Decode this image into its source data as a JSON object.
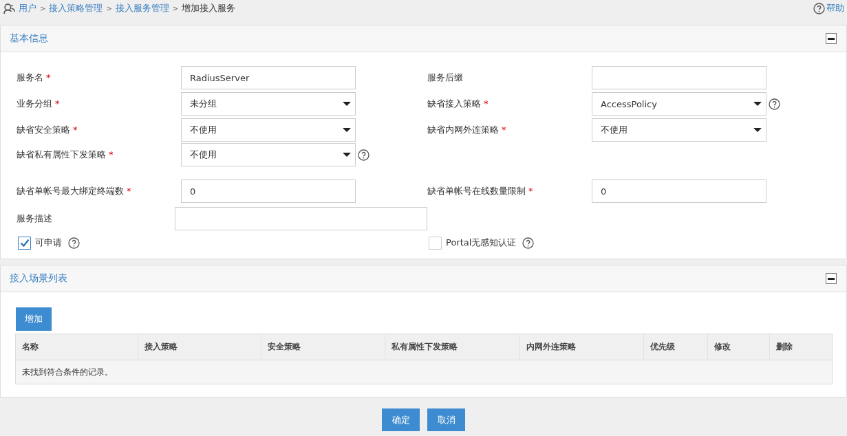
{
  "breadcrumb": [
    {
      "label": "用户",
      "link": true
    },
    {
      "separator": ">",
      "label": "接入策略管理",
      "link": true
    },
    {
      "separator": ">",
      "label": "接入服务管理",
      "link": true
    },
    {
      "separator": ">",
      "label": "增加接入服务",
      "link": false
    }
  ],
  "help": {
    "label": "帮助"
  },
  "basic_panel": {
    "title": "基本信息",
    "expanded": true,
    "rows": [
      [
        {
          "kind": "text",
          "label": "服务名",
          "required_mark": "*",
          "value": "RadiusServer"
        },
        {
          "kind": "text",
          "label": "服务后缀"
        }
      ],
      [
        {
          "kind": "select",
          "label": "业务分组",
          "required_mark": "*",
          "value": "未分组"
        },
        {
          "kind": "select",
          "label": "缺省接入策略",
          "required_mark": "*",
          "value": "AccessPolicy",
          "help": true
        }
      ],
      [
        {
          "kind": "select",
          "label": "缺省安全策略",
          "required_mark": "*",
          "value": "不使用"
        },
        {
          "kind": "select",
          "label": "缺省内网外连策略",
          "required_mark": "*",
          "value": "不使用"
        }
      ],
      [
        {
          "kind": "select",
          "label": "缺省私有属性下发策略",
          "required_mark": "*",
          "value": "不使用",
          "help": true
        }
      ],
      [
        {
          "kind": "text",
          "label": "缺省单帐号最大绑定终端数",
          "required_mark": "*",
          "value": "0"
        },
        {
          "kind": "text",
          "label": "缺省单帐号在线数量限制",
          "required_mark": "*",
          "value": "0"
        }
      ],
      [
        {
          "kind": "wide",
          "label": "服务描述"
        }
      ],
      [
        {
          "kind": "checkbox",
          "label": "可申请",
          "checked": true,
          "help": true
        },
        {
          "kind": "checkbox",
          "label": "Portal无感知认证",
          "checked": false,
          "help": true
        }
      ]
    ]
  },
  "scene_panel": {
    "title": "接入场景列表",
    "expanded": true,
    "add_button": "增加",
    "table": {
      "columns": [
        "名称",
        "接入策略",
        "安全策略",
        "私有属性下发策略",
        "内网外连策略",
        "优先级",
        "修改",
        "删除"
      ],
      "empty_message": "未找到符合条件的记录。"
    }
  },
  "buttons": [
    "确定",
    "取消"
  ]
}
